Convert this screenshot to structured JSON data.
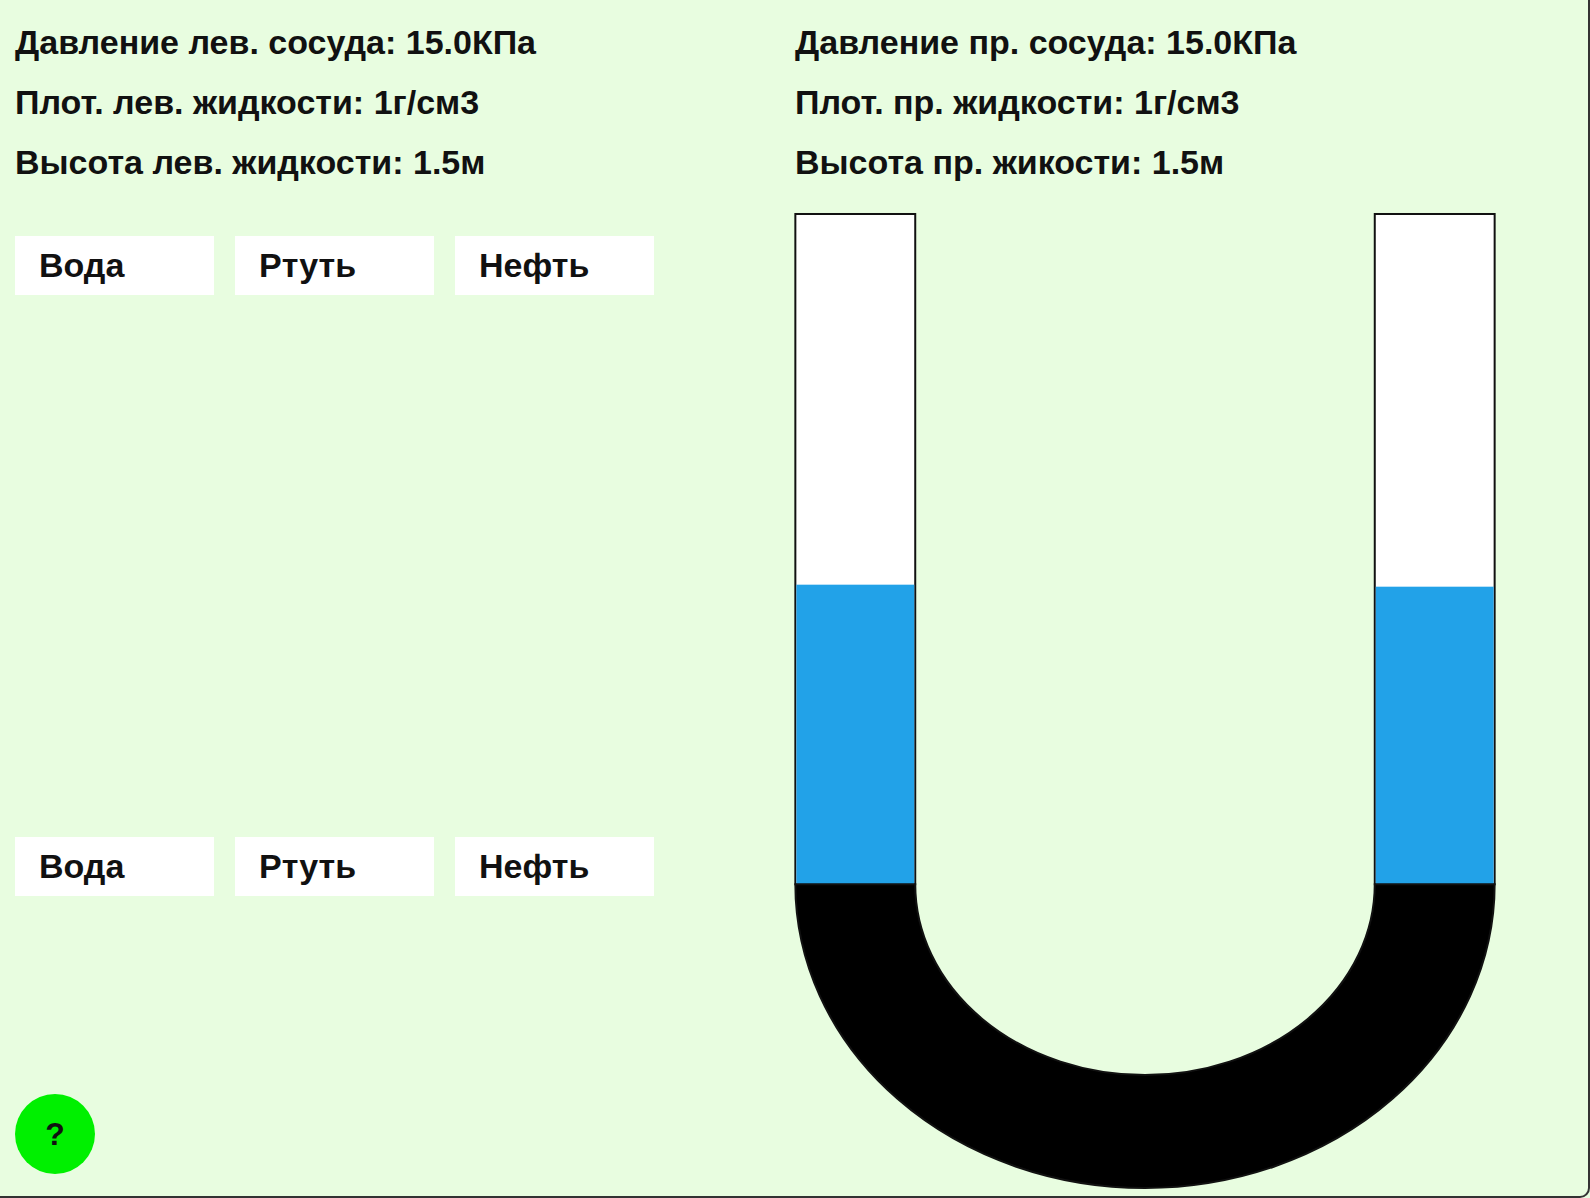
{
  "info": {
    "left": [
      "Давление лев. сосуда: 15.0КПа",
      "Плот. лев. жидкости: 1г/см3",
      "Высота лев. жидкости: 1.5м"
    ],
    "right": [
      "Давление пр. сосуда: 15.0КПа",
      "Плот. пр. жидкости: 1г/см3",
      "Высота пр. жикости: 1.5м"
    ]
  },
  "liquid_pickers": [
    {
      "buttons": [
        "Вода",
        "Ртуть",
        "Нефть"
      ]
    },
    {
      "buttons": [
        "Вода",
        "Ртуть",
        "Нефть"
      ]
    }
  ],
  "help_button": "?",
  "vessel": {
    "columns": [
      {
        "level": 0.447,
        "color": "#22a2e8"
      },
      {
        "level": 0.444,
        "color": "#22a2e8"
      }
    ],
    "base": {
      "color": "#000000"
    }
  }
}
